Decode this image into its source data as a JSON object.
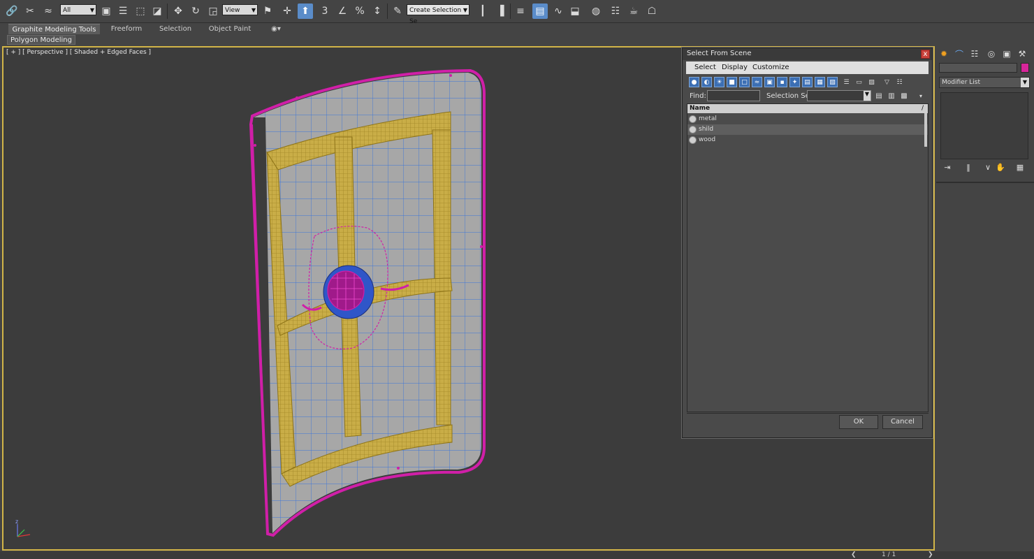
{
  "toolbar": {
    "selection_filter": "All",
    "ref_coord": "View",
    "named_selection_placeholder": "Create Selection Se",
    "snap_label": "3"
  },
  "ribbon": {
    "tabs": [
      {
        "label": "Graphite Modeling Tools"
      },
      {
        "label": "Freeform"
      },
      {
        "label": "Selection"
      },
      {
        "label": "Object Paint"
      }
    ],
    "panel_label": "Polygon Modeling"
  },
  "viewport": {
    "label": "[ + ] [ Perspective ] [ Shaded + Edged Faces ]",
    "axis_z": "z"
  },
  "timebar": {
    "frame_counter": "1 / 1"
  },
  "command_panel": {
    "modifier_list": "Modifier List",
    "object_color": "#d7259a"
  },
  "dialog": {
    "title": "Select From Scene",
    "close": "x",
    "menu": [
      "Select",
      "Display",
      "Customize"
    ],
    "find_label": "Find:",
    "selection_set_label": "Selection Set:",
    "list_header": "Name",
    "sort_indicator": "/",
    "items": [
      {
        "name": "metal",
        "selected": false
      },
      {
        "name": "shild",
        "selected": true
      },
      {
        "name": "wood",
        "selected": false
      }
    ],
    "ok_label": "OK",
    "cancel_label": "Cancel"
  },
  "colors": {
    "viewport_border": "#d2b548",
    "wire_blue": "#2f6fe0",
    "wire_magenta": "#d01fa8",
    "wire_gold": "#b89a2a"
  }
}
